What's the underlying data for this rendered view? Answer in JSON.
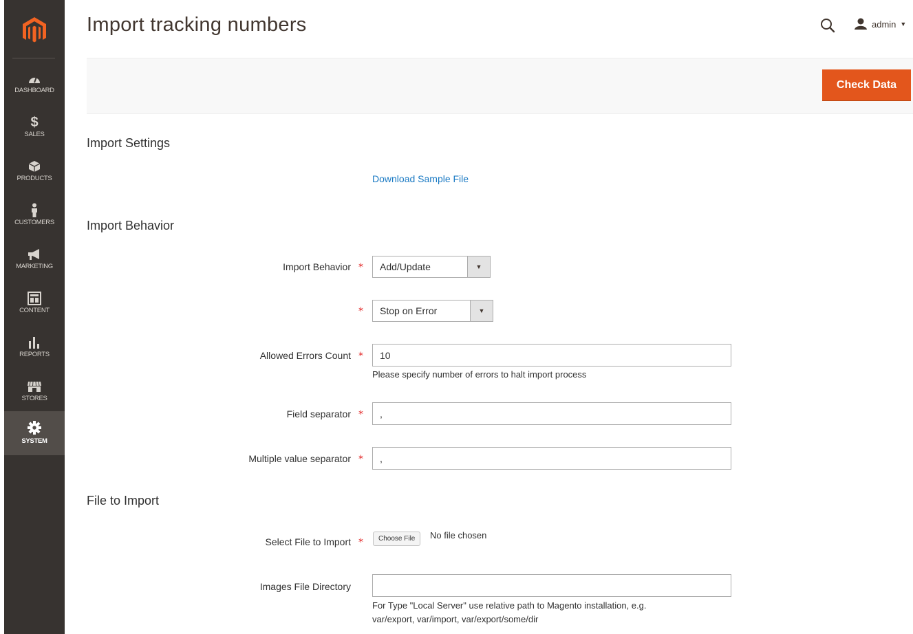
{
  "nav": {
    "items": [
      {
        "label": "DASHBOARD",
        "icon": "dashboard-icon"
      },
      {
        "label": "SALES",
        "icon": "dollar-icon"
      },
      {
        "label": "PRODUCTS",
        "icon": "cube-icon"
      },
      {
        "label": "CUSTOMERS",
        "icon": "person-icon"
      },
      {
        "label": "MARKETING",
        "icon": "megaphone-icon"
      },
      {
        "label": "CONTENT",
        "icon": "layout-icon"
      },
      {
        "label": "REPORTS",
        "icon": "bar-chart-icon"
      },
      {
        "label": "STORES",
        "icon": "store-icon"
      },
      {
        "label": "SYSTEM",
        "icon": "gear-icon",
        "active": true
      }
    ]
  },
  "header": {
    "title": "Import tracking numbers",
    "user": "admin"
  },
  "action_bar": {
    "check_label": "Check Data"
  },
  "sections": {
    "settings": "Import Settings",
    "behavior": "Import Behavior",
    "file": "File to Import"
  },
  "download_link": "Download Sample File",
  "form": {
    "behavior_label": "Import Behavior",
    "behavior_value": "Add/Update",
    "error_mode_value": "Stop on Error",
    "errors_count_label": "Allowed Errors Count",
    "errors_count_value": "10",
    "errors_count_note": "Please specify number of errors to halt import process",
    "field_sep_label": "Field separator",
    "field_sep_value": ",",
    "multi_sep_label": "Multiple value separator",
    "multi_sep_value": ",",
    "select_file_label": "Select File to Import",
    "choose_file_label": "Choose File",
    "file_status": "No file chosen",
    "images_dir_label": "Images File Directory",
    "images_dir_value": "",
    "images_dir_note_1": "For Type \"Local Server\" use relative path to Magento installation, e.g.",
    "images_dir_note_2": "var/export, var/import, var/export/some/dir"
  },
  "required_mark": "*",
  "colors": {
    "accent": "#e3561c",
    "nav_bg": "#373330",
    "link": "#1979c3",
    "required": "#e22626"
  }
}
